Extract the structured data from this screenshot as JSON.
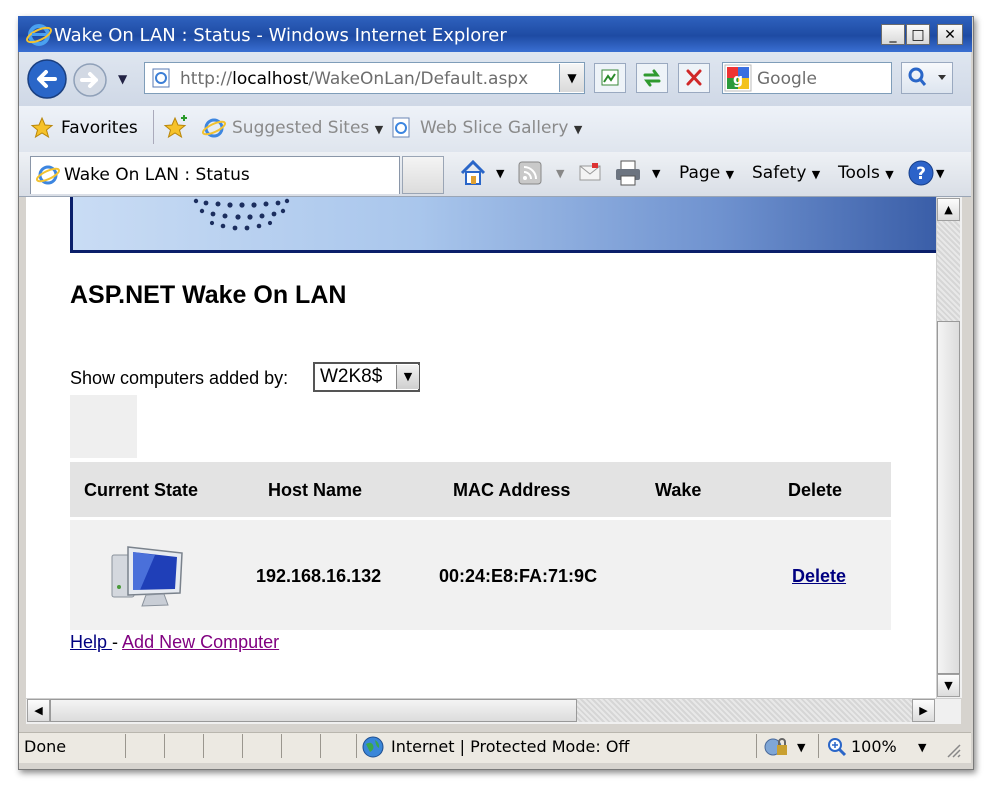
{
  "window": {
    "title": "Wake On LAN : Status - Windows Internet Explorer"
  },
  "address_bar": {
    "url_prefix": "http://",
    "url_host": "localhost",
    "url_path": "/WakeOnLan/Default.aspx"
  },
  "search": {
    "placeholder": "Google"
  },
  "favorites_bar": {
    "favorites": "Favorites",
    "suggested": "Suggested Sites",
    "webslice": "Web Slice Gallery"
  },
  "tab": {
    "title": "Wake On LAN : Status"
  },
  "command_bar": {
    "page": "Page",
    "safety": "Safety",
    "tools": "Tools"
  },
  "page": {
    "heading": "ASP.NET Wake On LAN",
    "filter_label": "Show computers added by:",
    "filter_value": "W2K8$",
    "table": {
      "headers": [
        "Current State",
        "Host Name",
        "MAC Address",
        "Wake",
        "Delete"
      ],
      "rows": [
        {
          "host": "192.168.16.132",
          "mac": "00:24:E8:FA:71:9C",
          "wake": "",
          "delete": "Delete"
        }
      ]
    },
    "links": {
      "help": "Help ",
      "separator": "- ",
      "add": "Add New Computer"
    }
  },
  "status_bar": {
    "done": "Done",
    "zone": "Internet | Protected Mode: Off",
    "zoom": "100%"
  },
  "colors": {
    "title_bar": "#2f62bf",
    "banner_dark": "#3a5ea8",
    "link": "#000080",
    "visited_link": "#800080"
  }
}
